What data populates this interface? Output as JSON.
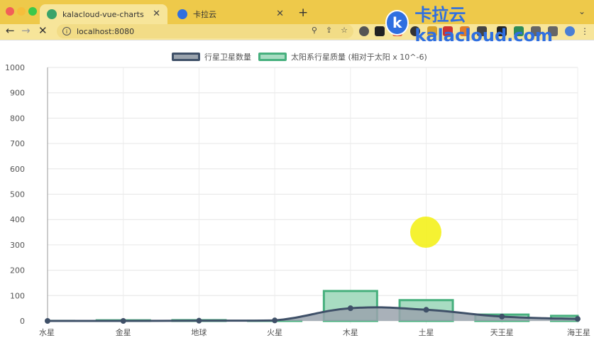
{
  "browser": {
    "tabs": [
      {
        "title": "kalacloud-vue-charts",
        "active": true
      },
      {
        "title": "卡拉云",
        "active": false
      }
    ],
    "close_glyph": "✕",
    "new_tab_glyph": "+",
    "url": "localhost:8080",
    "brand_logo_text": "k",
    "brand_text": "卡拉云 kalacloud.com",
    "accent_color": "#eec94a"
  },
  "chart_data": {
    "type": "bar",
    "categories": [
      "水星",
      "金星",
      "地球",
      "火星",
      "木星",
      "土星",
      "天王星",
      "海王星"
    ],
    "ylim": [
      0,
      1000
    ],
    "yticks": [
      0,
      100,
      200,
      300,
      400,
      500,
      600,
      700,
      800,
      900,
      1000
    ],
    "series": [
      {
        "name": "行星卫星数量",
        "type": "line",
        "values": [
          0,
          0,
          1,
          2,
          50,
          44,
          17,
          8
        ],
        "color": "#3f5068",
        "fill": "#9aa3ad"
      },
      {
        "name": "太阳系行星质量 (相对于太阳 x 10^-6)",
        "type": "bar",
        "values": [
          0.2,
          2.4,
          3,
          0.3,
          118,
          82,
          25,
          20
        ],
        "color": "#47b07e",
        "fill": "#a8dcc2"
      }
    ],
    "grid": true,
    "legend": "top-center"
  }
}
